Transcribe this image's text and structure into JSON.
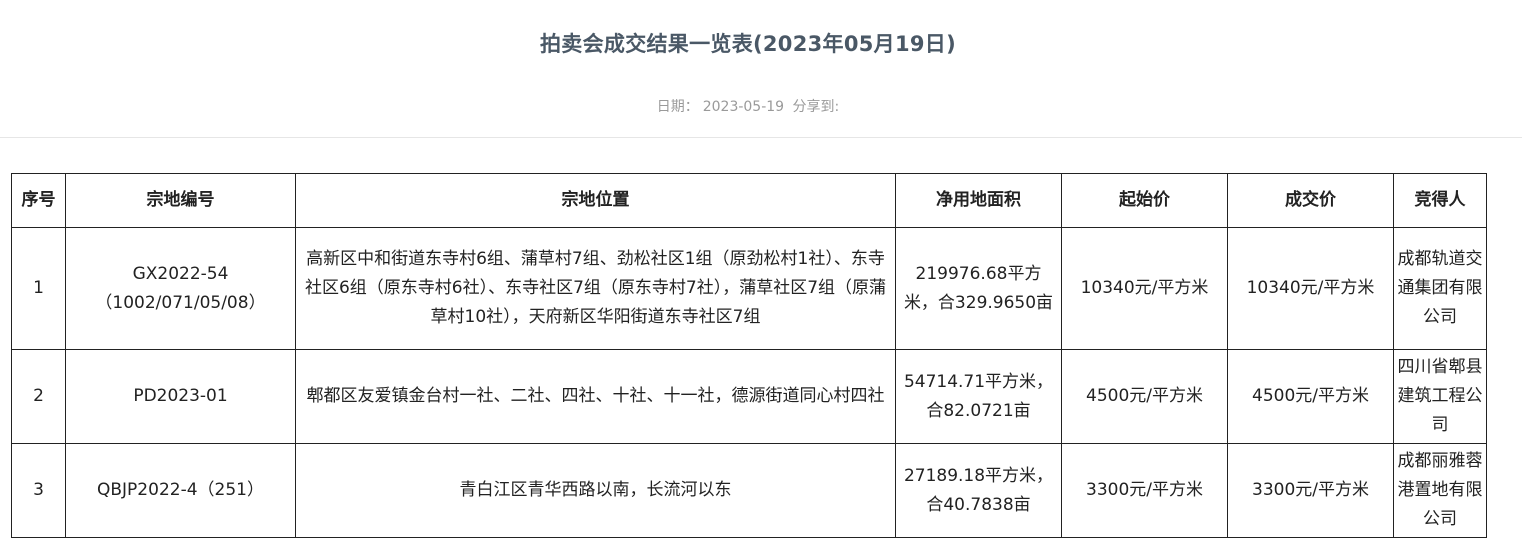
{
  "page": {
    "title": "拍卖会成交结果一览表(2023年05月19日)",
    "date_label": "日期：",
    "date": "2023-05-19",
    "share_label": "分享到:"
  },
  "table": {
    "headers": [
      "序号",
      "宗地编号",
      "宗地位置",
      "净用地面积",
      "起始价",
      "成交价",
      "竞得人"
    ],
    "rows": [
      {
        "index": "1",
        "parcel_code": "GX2022-54",
        "parcel_code_sub": "（1002/071/05/08）",
        "location": "高新区中和街道东寺村6组、蒲草村7组、劲松社区1组（原劲松村1社）、东寺社区6组（原东寺村6社）、东寺社区7组（原东寺村7社），蒲草社区7组（原蒲草村10社），天府新区华阳街道东寺社区7组",
        "net_area": "219976.68平方米，合329.9650亩",
        "start_price": "10340元/平方米",
        "deal_price": "10340元/平方米",
        "winner": "成都轨道交通集团有限公司"
      },
      {
        "index": "2",
        "parcel_code": "PD2023-01",
        "parcel_code_sub": "",
        "location": "郫都区友爱镇金台村一社、二社、四社、十社、十一社，德源街道同心村四社",
        "net_area": "54714.71平方米，合82.0721亩",
        "start_price": "4500元/平方米",
        "deal_price": "4500元/平方米",
        "winner": "四川省郫县建筑工程公司"
      },
      {
        "index": "3",
        "parcel_code": "QBJP2022-4（251）",
        "parcel_code_sub": "",
        "location": "青白江区青华西路以南，长流河以东",
        "net_area": "27189.18平方米，合40.7838亩",
        "start_price": "3300元/平方米",
        "deal_price": "3300元/平方米",
        "winner": "成都丽雅蓉港置地有限公司"
      }
    ]
  }
}
